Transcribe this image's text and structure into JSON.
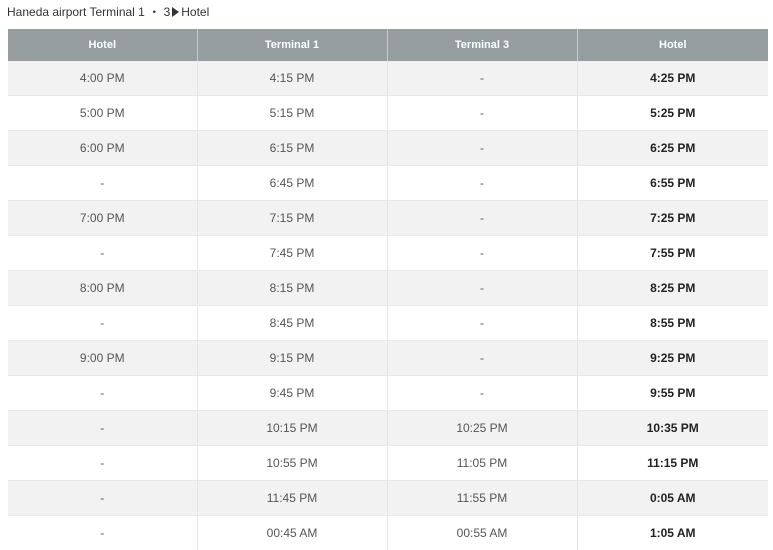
{
  "title": {
    "prefix": "Haneda airport Terminal 1",
    "separator": "・",
    "suffix": "3",
    "destination": "Hotel"
  },
  "table": {
    "headers": [
      "Hotel",
      "Terminal 1",
      "Terminal 3",
      "Hotel"
    ],
    "rows": [
      [
        "4:00 PM",
        "4:15 PM",
        "-",
        "4:25 PM"
      ],
      [
        "5:00 PM",
        "5:15 PM",
        "-",
        "5:25 PM"
      ],
      [
        "6:00 PM",
        "6:15 PM",
        "-",
        "6:25 PM"
      ],
      [
        "-",
        "6:45 PM",
        "-",
        "6:55 PM"
      ],
      [
        "7:00 PM",
        "7:15 PM",
        "-",
        "7:25 PM"
      ],
      [
        "-",
        "7:45 PM",
        "-",
        "7:55 PM"
      ],
      [
        "8:00 PM",
        "8:15 PM",
        "-",
        "8:25 PM"
      ],
      [
        "-",
        "8:45 PM",
        "-",
        "8:55 PM"
      ],
      [
        "9:00 PM",
        "9:15 PM",
        "-",
        "9:25 PM"
      ],
      [
        "-",
        "9:45 PM",
        "-",
        "9:55 PM"
      ],
      [
        "-",
        "10:15 PM",
        "10:25 PM",
        "10:35 PM"
      ],
      [
        "-",
        "10:55 PM",
        "11:05 PM",
        "11:15 PM"
      ],
      [
        "-",
        "11:45 PM",
        "11:55 PM",
        "0:05 AM"
      ],
      [
        "-",
        "00:45 AM",
        "00:55 AM",
        "1:05 AM"
      ]
    ]
  },
  "colors": {
    "header_bg": "#959d9f",
    "row_alt_bg": "#f2f2f2"
  }
}
